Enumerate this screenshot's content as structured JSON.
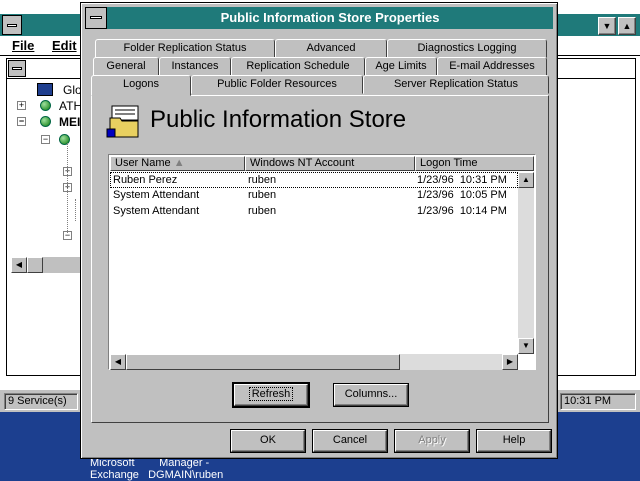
{
  "background_window": {
    "menu": [
      "File",
      "Edit"
    ],
    "tree": [
      {
        "label": "Glol"
      },
      {
        "label": "ATH"
      },
      {
        "label": "MEI"
      }
    ],
    "status": {
      "left": "9 Service(s)",
      "right": "10:31 PM"
    }
  },
  "taskbar": {
    "line1": "Microsoft        Manager -",
    "line2": "Exchange   DGMAIN\\ruben"
  },
  "dialog": {
    "title": "Public Information Store Properties",
    "tabs_row1": [
      "Folder Replication Status",
      "Advanced",
      "Diagnostics Logging"
    ],
    "tabs_row2": [
      "General",
      "Instances",
      "Replication Schedule",
      "Age Limits",
      "E-mail Addresses"
    ],
    "tabs_row3": [
      "Logons",
      "Public Folder Resources",
      "Server Replication Status"
    ],
    "active_tab": "Logons",
    "store_name": "Public Information Store",
    "icon": "public-store-icon",
    "columns": [
      "User Name",
      "Windows NT Account",
      "Logon Time"
    ],
    "rows": [
      {
        "user": "Ruben Perez",
        "account": "ruben",
        "time": "1/23/96  10:31 PM"
      },
      {
        "user": "System Attendant",
        "account": "ruben",
        "time": "1/23/96  10:05 PM"
      },
      {
        "user": "System Attendant",
        "account": "ruben",
        "time": "1/23/96  10:14 PM"
      }
    ],
    "refresh_label": "Refresh",
    "columns_label": "Columns...",
    "buttons": {
      "ok": "OK",
      "cancel": "Cancel",
      "apply": "Apply",
      "help": "Help"
    }
  }
}
